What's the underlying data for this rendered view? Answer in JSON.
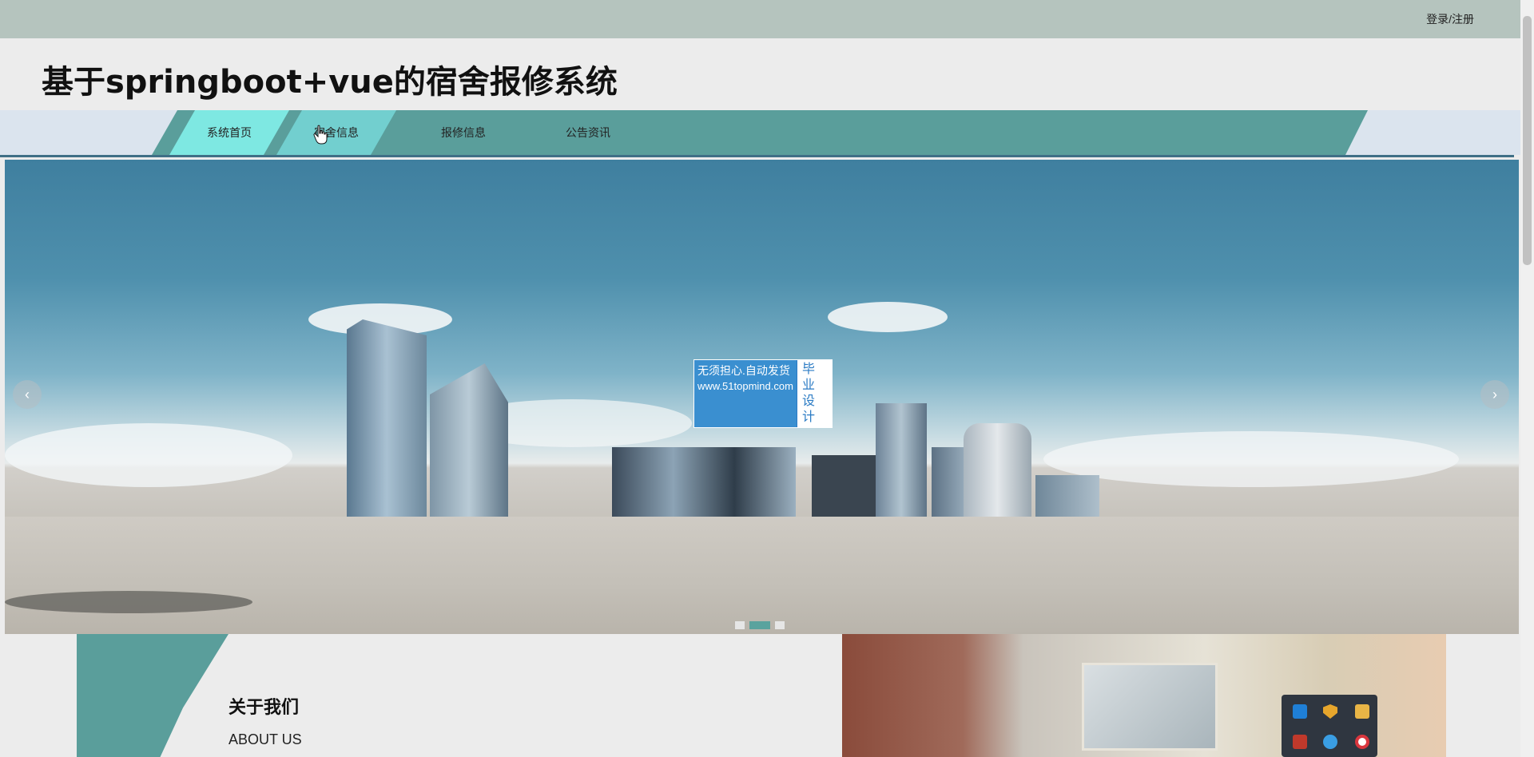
{
  "topbar": {
    "login_label": "登录/注册"
  },
  "header": {
    "title": "基于springboot+vue的宿舍报修系统"
  },
  "nav": {
    "items": [
      {
        "label": "系统首页",
        "state": "active"
      },
      {
        "label": "宿舍信息",
        "state": "hover"
      },
      {
        "label": "报修信息",
        "state": "normal"
      },
      {
        "label": "公告资讯",
        "state": "normal"
      }
    ]
  },
  "banner": {
    "watermark_line1": "无须担心.自动发货",
    "watermark_line2": "www.51topmind.com",
    "watermark_badge": "毕业设计",
    "slides_total": 3,
    "active_slide": 2,
    "prev_icon": "chevron-left-icon",
    "next_icon": "chevron-right-icon"
  },
  "about": {
    "title": "关于我们",
    "subtitle": "ABOUT US"
  },
  "colors": {
    "accent": "#5a9e9b",
    "active_tab": "#7ee8e2",
    "topbar": "#b5c4be"
  }
}
